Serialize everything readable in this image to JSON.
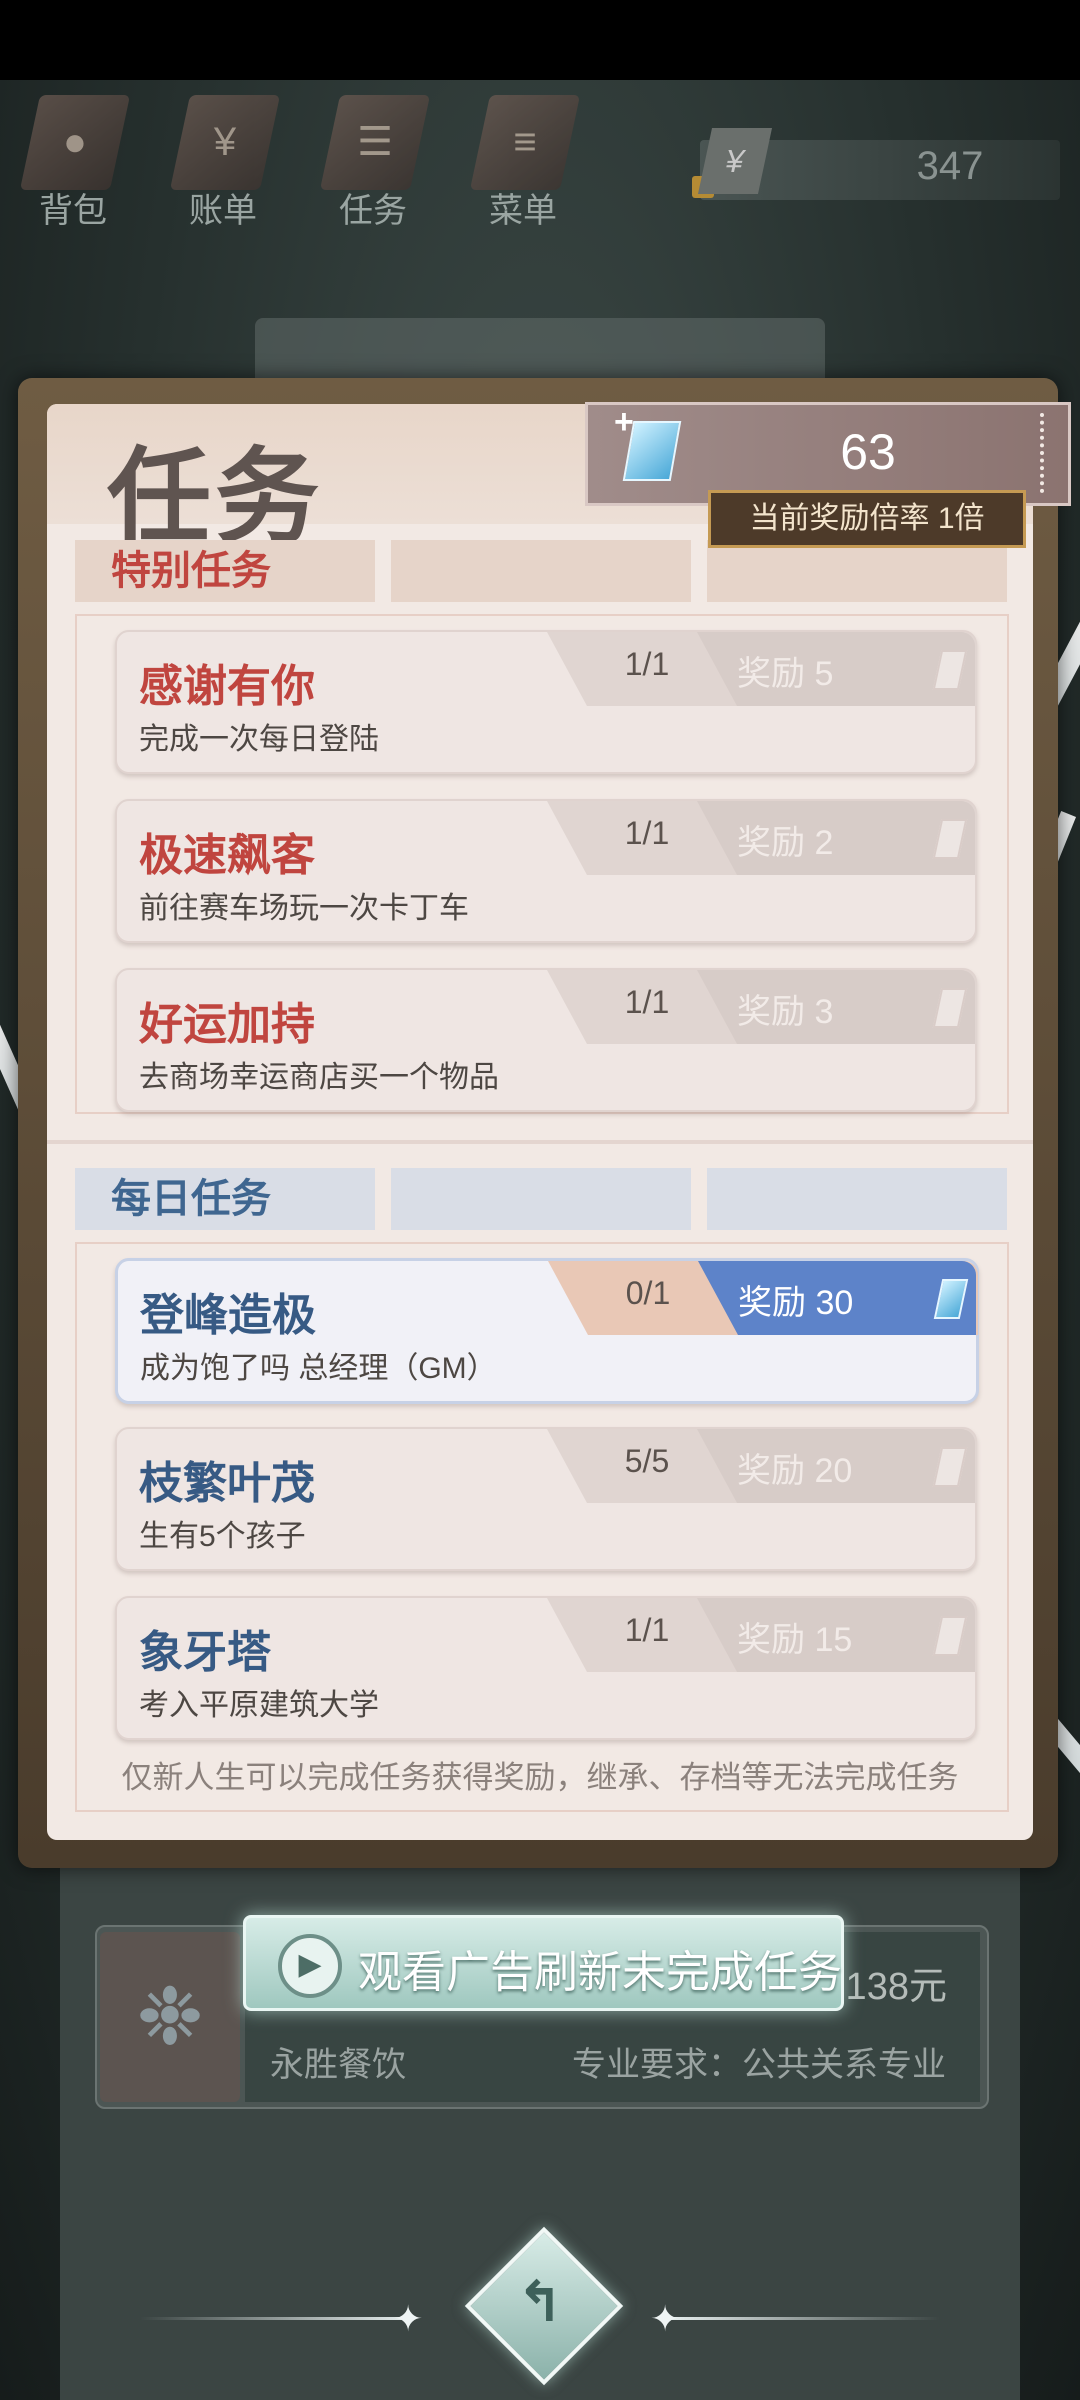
{
  "top_nav": {
    "items": [
      {
        "label": "背包"
      },
      {
        "label": "账单"
      },
      {
        "label": "任务"
      },
      {
        "label": "菜单"
      }
    ],
    "currency_symbol": "¥",
    "money": "347"
  },
  "dialog": {
    "title": "任务",
    "gems": "63",
    "multiplier": "当前奖励倍率 1倍",
    "special_section": {
      "label": "特别任务",
      "tasks": [
        {
          "title": "感谢有你",
          "desc": "完成一次每日登陆",
          "progress": "1/1",
          "reward": "奖励 5"
        },
        {
          "title": "极速飙客",
          "desc": "前往赛车场玩一次卡丁车",
          "progress": "1/1",
          "reward": "奖励 2"
        },
        {
          "title": "好运加持",
          "desc": "去商场幸运商店买一个物品",
          "progress": "1/1",
          "reward": "奖励 3"
        }
      ]
    },
    "daily_section": {
      "label": "每日任务",
      "tasks": [
        {
          "title": "登峰造极",
          "desc": "成为饱了吗 总经理（GM）",
          "progress": "0/1",
          "reward": "奖励 30",
          "active": true
        },
        {
          "title": "枝繁叶茂",
          "desc": "生有5个孩子",
          "progress": "5/5",
          "reward": "奖励 20"
        },
        {
          "title": "象牙塔",
          "desc": "考入平原建筑大学",
          "progress": "1/1",
          "reward": "奖励 15"
        }
      ]
    },
    "footer_note": "仅新人生可以完成任务获得奖励，继承、存档等无法完成任务"
  },
  "background_card": {
    "salary": ",138元",
    "company": "永胜餐饮",
    "major": "专业要求：公共关系专业"
  },
  "ad_button": {
    "label": "观看广告刷新未完成任务"
  },
  "colors": {
    "special_accent": "#c0453f",
    "daily_accent": "#3f6690",
    "active_reward": "#5d83c9"
  }
}
